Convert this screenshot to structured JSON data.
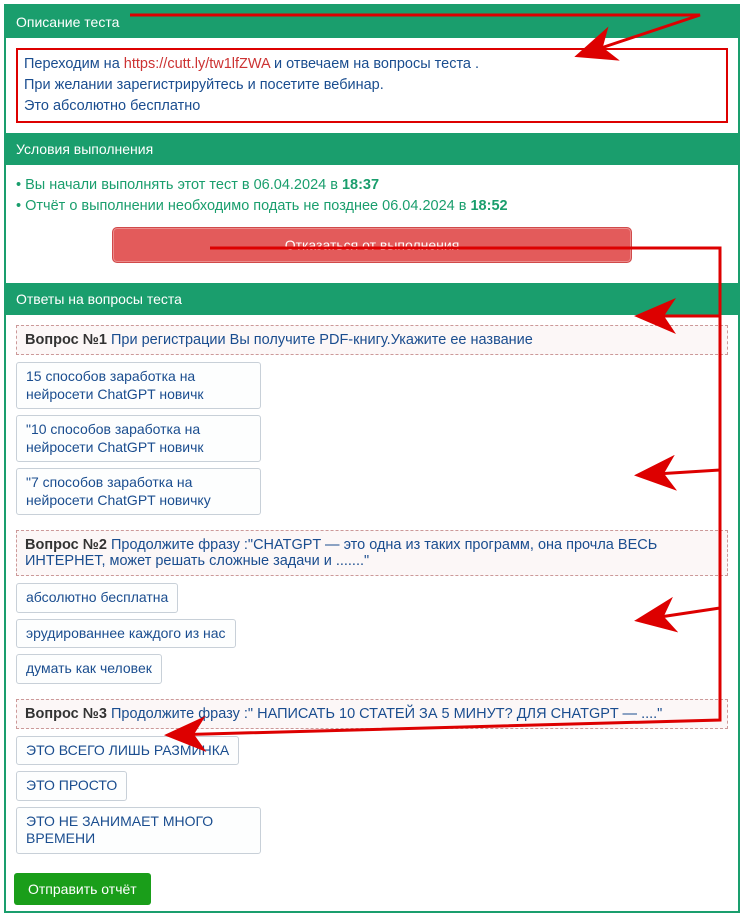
{
  "sections": {
    "desc": {
      "title": "Описание теста",
      "line1a": "Переходим на ",
      "link": "https://cutt.ly/tw1lfZWA",
      "line1b": " и отвечаем на вопросы теста .",
      "line2": "При желании зарегистрируйтесь и посетите вебинар.",
      "line3": "Это абсолютно бесплатно"
    },
    "cond": {
      "title": "Условия выполнения",
      "start_prefix": "• Вы начали выполнять этот тест в 06.04.2024 в ",
      "start_time": "18:37",
      "due_prefix": "• Отчёт о выполнении необходимо подать не позднее 06.04.2024 в ",
      "due_time": "18:52",
      "refuse": "Отказаться от выполнения"
    },
    "answers": {
      "title": "Ответы на вопросы теста"
    }
  },
  "questions": [
    {
      "num": "Вопрос №1",
      "text": " При регистрации Вы получите PDF-книгу.Укажите ее название",
      "options": [
        "15 способов заработка на нейросети ChatGPT новичк",
        "\"10 способов заработка на нейросети ChatGPT новичк",
        "\"7 способов заработка на нейросети ChatGPT новичку"
      ]
    },
    {
      "num": "Вопрос №2",
      "text": " Продолжите фразу :\"CHATGPT — это одна из таких программ, она прочла ВЕСЬ ИНТЕРНЕТ, может решать сложные задачи и .......\"",
      "options": [
        "абсолютно бесплатна",
        "эрудированнее каждого из нас",
        "думать как человек"
      ]
    },
    {
      "num": "Вопрос №3",
      "text": " Продолжите фразу :\" НАПИСАТЬ 10 СТАТЕЙ ЗА 5 МИНУТ? ДЛЯ CHATGPT — ....\"",
      "options": [
        "ЭТО ВСЕГО ЛИШЬ РАЗМИНКА",
        "ЭТО ПРОСТО",
        "ЭТО НЕ ЗАНИМАЕТ МНОГО ВРЕМЕНИ"
      ]
    }
  ],
  "submit": "Отправить отчёт"
}
